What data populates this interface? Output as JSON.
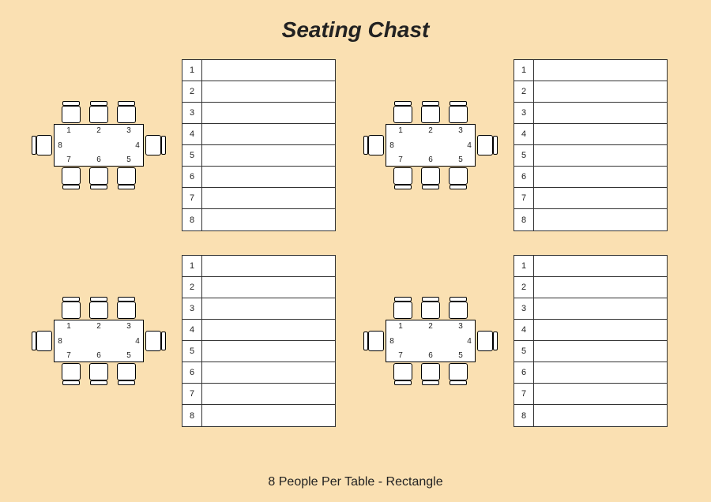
{
  "title": "Seating Chast",
  "subtitle": "8 People Per Table - Rectangle",
  "seat_numbers": [
    "1",
    "2",
    "3",
    "4",
    "5",
    "6",
    "7",
    "8"
  ],
  "list_numbers": [
    "1",
    "2",
    "3",
    "4",
    "5",
    "6",
    "7",
    "8"
  ],
  "units": [
    {
      "guests": [
        "",
        "",
        "",
        "",
        "",
        "",
        "",
        ""
      ]
    },
    {
      "guests": [
        "",
        "",
        "",
        "",
        "",
        "",
        "",
        ""
      ]
    },
    {
      "guests": [
        "",
        "",
        "",
        "",
        "",
        "",
        "",
        ""
      ]
    },
    {
      "guests": [
        "",
        "",
        "",
        "",
        "",
        "",
        "",
        ""
      ]
    }
  ]
}
